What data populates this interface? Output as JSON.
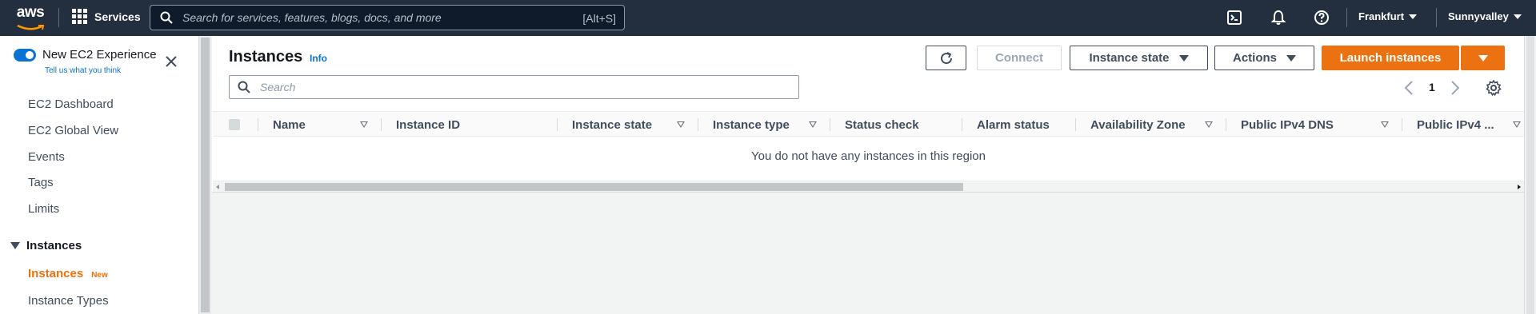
{
  "topnav": {
    "logo_text": "aws",
    "services_label": "Services",
    "search_placeholder": "Search for services, features, blogs, docs, and more",
    "search_shortcut": "[Alt+S]",
    "region": "Frankfurt",
    "account": "Sunnyvalley",
    "icons": [
      "cloudshell-icon",
      "bell-icon",
      "help-icon"
    ]
  },
  "sidebar": {
    "experience_title": "New EC2 Experience",
    "experience_link": "Tell us what you think",
    "toggle_on": true,
    "items": [
      {
        "label": "EC2 Dashboard"
      },
      {
        "label": "EC2 Global View"
      },
      {
        "label": "Events"
      },
      {
        "label": "Tags"
      },
      {
        "label": "Limits"
      }
    ],
    "section_label": "Instances",
    "section_items": [
      {
        "label": "Instances",
        "badge": "New",
        "active": true
      },
      {
        "label": "Instance Types"
      }
    ]
  },
  "main": {
    "title": "Instances",
    "info_label": "Info",
    "buttons": {
      "connect": "Connect",
      "instance_state": "Instance state",
      "actions": "Actions",
      "launch": "Launch instances"
    },
    "filter_placeholder": "Search",
    "page_number": "1",
    "columns": [
      "Name",
      "Instance ID",
      "Instance state",
      "Instance type",
      "Status check",
      "Alarm status",
      "Availability Zone",
      "Public IPv4 DNS",
      "Public IPv4 ..."
    ],
    "empty_message": "You do not have any instances in this region"
  },
  "colors": {
    "nav_bg": "#232f3e",
    "accent_orange": "#ec7211",
    "link_blue": "#0972d3"
  }
}
